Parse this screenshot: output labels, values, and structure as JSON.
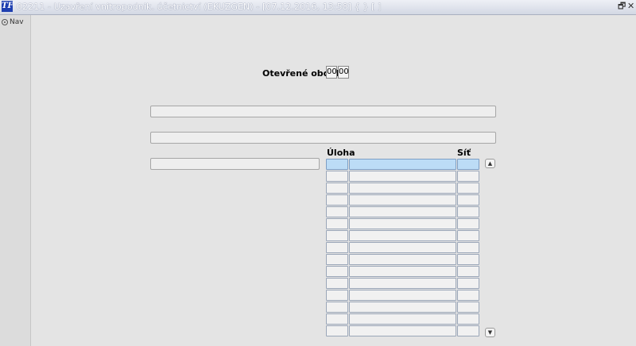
{
  "window": {
    "title": "02211 - Uzavření vnitropodnik. účetnictví (EKUZGEN) - [07.12.2016, 13:58] { } [ ]",
    "app_icon": "TF",
    "restore_glyph": "🗗",
    "close_glyph": "✕"
  },
  "sidebar": {
    "nav_label": "Nav"
  },
  "form": {
    "open_period_label": "Otevřené období",
    "period_month": "00",
    "period_year": "00",
    "field1_value": "",
    "field2_value": "",
    "field3_value": ""
  },
  "grid": {
    "col_task": "Úloha",
    "col_net": "Síť",
    "rows": [
      "",
      "",
      "",
      "",
      "",
      "",
      "",
      "",
      "",
      "",
      "",
      "",
      "",
      "",
      ""
    ],
    "scroll_up": "▲",
    "scroll_down": "▼"
  },
  "colors": {
    "selected_row": "#bcdcf6",
    "background": "#e4e4e4"
  }
}
